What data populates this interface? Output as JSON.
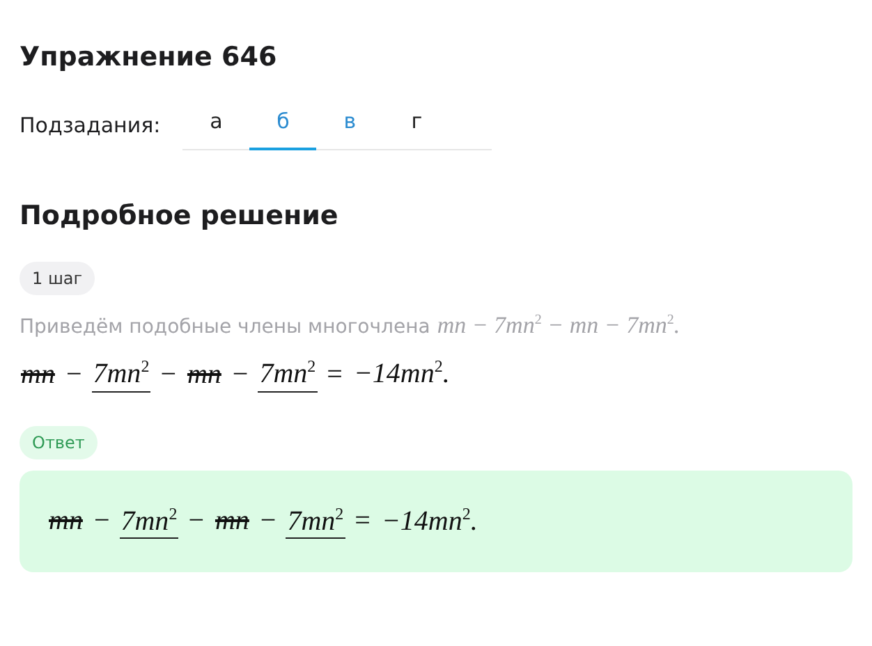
{
  "title": "Упражнение 646",
  "subtasks": {
    "label": "Подзадания:",
    "tabs": [
      {
        "label": "а",
        "selected": false,
        "hovered": false
      },
      {
        "label": "б",
        "selected": true,
        "hovered": false
      },
      {
        "label": "в",
        "selected": false,
        "hovered": true
      },
      {
        "label": "г",
        "selected": false,
        "hovered": false
      }
    ]
  },
  "solution_heading": "Подробное решение",
  "steps": [
    {
      "badge": "1 шаг",
      "text": "Приведём подобные члены многочлена",
      "expression": "mn − 7mn$^{2}$ − mn − 7mn$^{2}$.",
      "math": [
        {
          "kind": "struck",
          "text": "mn"
        },
        {
          "kind": "op",
          "text": "−"
        },
        {
          "kind": "underlined",
          "text": "7mn$^{2}$"
        },
        {
          "kind": "op",
          "text": "−"
        },
        {
          "kind": "struck",
          "text": "mn"
        },
        {
          "kind": "op",
          "text": "−"
        },
        {
          "kind": "underlined",
          "text": "7mn$^{2}$"
        },
        {
          "kind": "op",
          "text": "="
        },
        {
          "kind": "plain",
          "text": "−14mn$^{2}$."
        }
      ]
    }
  ],
  "answer": {
    "badge": "Ответ",
    "math": [
      {
        "kind": "struck",
        "text": "mn"
      },
      {
        "kind": "op",
        "text": "−"
      },
      {
        "kind": "underlined",
        "text": "7mn$^{2}$"
      },
      {
        "kind": "op",
        "text": "−"
      },
      {
        "kind": "struck",
        "text": "mn"
      },
      {
        "kind": "op",
        "text": "−"
      },
      {
        "kind": "underlined",
        "text": "7mn$^{2}$"
      },
      {
        "kind": "op",
        "text": "="
      },
      {
        "kind": "plain",
        "text": "−14mn$^{2}$."
      }
    ]
  }
}
